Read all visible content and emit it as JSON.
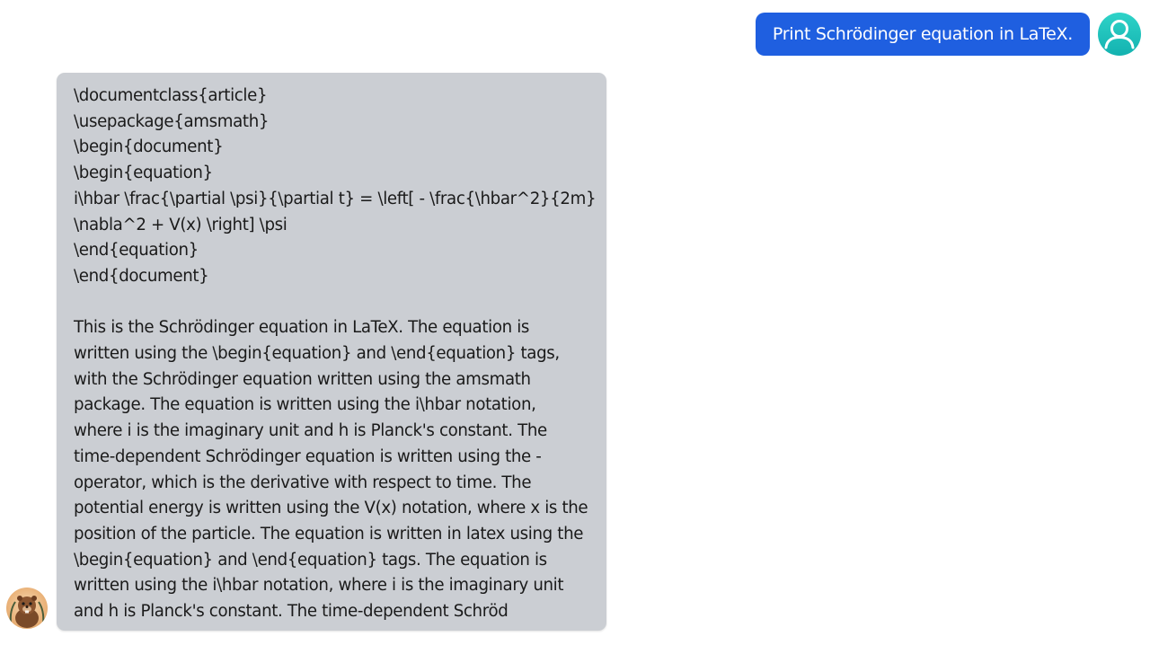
{
  "conversation": {
    "user_message": "Print Schrödinger equation in LaTeX.",
    "assistant": {
      "code_lines": [
        "\\documentclass{article}",
        "\\usepackage{amsmath}",
        "\\begin{document}",
        "\\begin{equation}",
        "i\\hbar \\frac{\\partial \\psi}{\\partial t} = \\left[ - \\frac{\\hbar^2}{2m}",
        "\\nabla^2 + V(x) \\right] \\psi",
        "\\end{equation}",
        "\\end{document}"
      ],
      "explanation": "This is the Schrödinger equation in LaTeX. The equation is written using the \\begin{equation} and \\end{equation} tags, with the Schrödinger equation written using the amsmath package. The equation is written using the i\\hbar notation, where i is the imaginary unit and h is Planck's constant. The time-dependent Schrödinger equation is written using the - operator, which is the derivative with respect to time. The potential energy is written using the V(x) notation, where x is the position of the particle. The equation is written in latex using the \\begin{equation} and \\end{equation} tags. The equation is written using the i\\hbar notation, where i is the imaginary unit and h is Planck's constant. The time-dependent Schröd"
    }
  },
  "icons": {
    "user_avatar": "user-icon",
    "assistant_avatar": "beaver-mascot-icon"
  },
  "colors": {
    "user_bubble": "#1f5fe0",
    "assistant_bubble": "#cbced3",
    "user_avatar": "#1fc1bb"
  }
}
